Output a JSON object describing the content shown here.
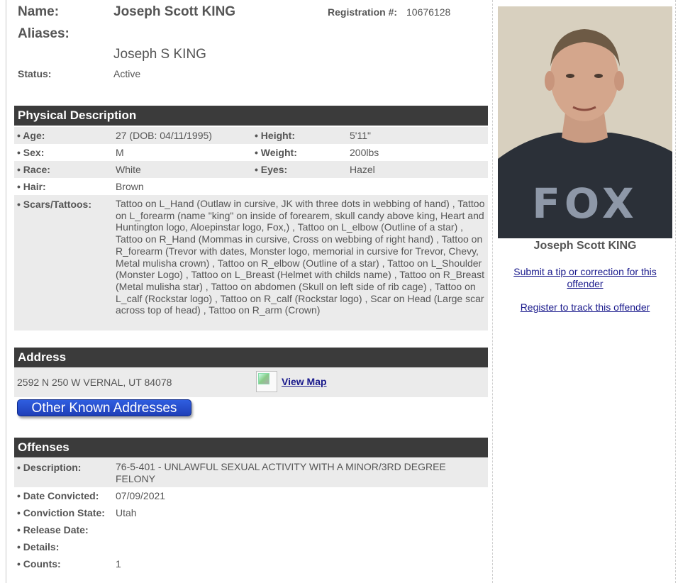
{
  "header": {
    "name_label": "Name:",
    "name_value": "Joseph Scott KING",
    "registration_label": "Registration #:",
    "registration_value": "10676128",
    "aliases_label": "Aliases:",
    "alias_value": "Joseph S KING",
    "status_label": "Status:",
    "status_value": "Active"
  },
  "physical": {
    "title": "Physical Description",
    "age_label": "Age:",
    "age_value": "27  (DOB: 04/11/1995)",
    "height_label": "Height:",
    "height_value": "5'11\"",
    "sex_label": "Sex:",
    "sex_value": "M",
    "weight_label": "Weight:",
    "weight_value": "200lbs",
    "race_label": "Race:",
    "race_value": "White",
    "eyes_label": "Eyes:",
    "eyes_value": "Hazel",
    "hair_label": "Hair:",
    "hair_value": "Brown",
    "scars_label": "Scars/Tattoos:",
    "scars_value": "Tattoo on L_Hand (Outlaw in cursive, JK with three dots in webbing of hand) , Tattoo on L_forearm (name \"king\" on inside of forearem, skull candy above king, Heart and Huntington logo, Aloepinstar logo, Fox,) , Tattoo on L_elbow (Outline of a star) , Tattoo on R_Hand (Mommas in cursive, Cross on webbing of right hand) , Tattoo on R_forearm (Trevor with dates, Monster logo, memorial in cursive for Trevor, Chevy, Metal mulisha crown) , Tattoo on R_elbow (Outline of a star) , Tattoo on L_Shoulder (Monster Logo) , Tattoo on L_Breast (Helmet with childs name) , Tattoo on R_Breast (Metal mulisha star) , Tattoo on abdomen (Skull on left side of rib cage) , Tattoo on L_calf (Rockstar logo) , Tattoo on R_calf (Rockstar logo) , Scar on Head (Large scar across top of head) , Tattoo on R_arm (Crown)"
  },
  "address": {
    "title": "Address",
    "value": "2592 N 250 W VERNAL, UT 84078",
    "view_map": "View Map",
    "other_button": "Other Known Addresses"
  },
  "offenses": {
    "title": "Offenses",
    "description_label": "Description:",
    "description_value": "76-5-401 - UNLAWFUL SEXUAL ACTIVITY WITH A MINOR/3RD DEGREE FELONY",
    "date_label": "Date Convicted:",
    "date_value": "07/09/2021",
    "state_label": "Conviction State:",
    "state_value": "Utah",
    "release_label": "Release Date:",
    "release_value": "",
    "details_label": "Details:",
    "details_value": "",
    "counts_label": "Counts:",
    "counts_value": "1"
  },
  "sidebar": {
    "photo_caption": "Joseph Scott KING",
    "shirt_text": "FOX",
    "tip_link": "Submit a tip or correction for this offender",
    "register_link": "Register to track this offender"
  }
}
